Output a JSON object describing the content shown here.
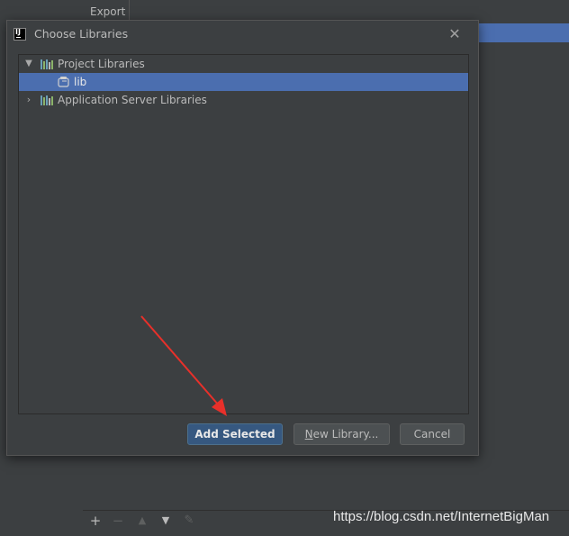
{
  "background": {
    "tab_label": "Export",
    "toolbar_icons": [
      "plus-icon",
      "minus-icon",
      "up-icon",
      "down-icon",
      "edit-icon"
    ]
  },
  "dialog": {
    "title": "Choose Libraries",
    "tree": [
      {
        "label": "Project Libraries",
        "expanded": true,
        "icon": "library-icon"
      },
      {
        "label": "lib",
        "selected": true,
        "icon": "jar-icon"
      },
      {
        "label": "Application Server Libraries",
        "expanded": false,
        "icon": "library-icon"
      }
    ],
    "buttons": {
      "add_selected": "Add Selected",
      "new_library_mnemonic": "N",
      "new_library_rest": "ew Library...",
      "cancel": "Cancel"
    }
  },
  "watermark": "https://blog.csdn.net/InternetBigMan",
  "colors": {
    "background": "#3c3f41",
    "selection": "#4b6eaf",
    "primary_button": "#365880",
    "annotation_arrow": "#e8302a"
  }
}
